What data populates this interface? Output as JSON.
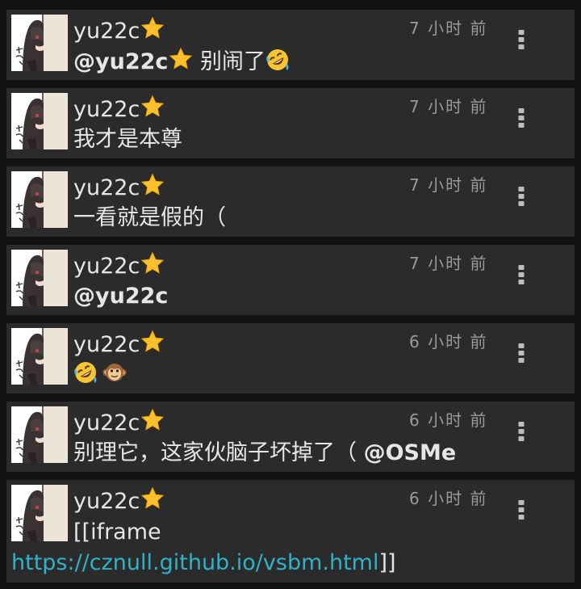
{
  "messages": [
    {
      "user": "yu22c",
      "time": "7 小时 前",
      "mention": "@yu22c",
      "text": " 别闹了",
      "emoji": "rofl"
    },
    {
      "user": "yu22c",
      "time": "7 小时 前",
      "text": "我才是本尊"
    },
    {
      "user": "yu22c",
      "time": "7 小时 前",
      "text": "一看就是假的（"
    },
    {
      "user": "yu22c",
      "time": "7 小时 前",
      "mention": "@yu22c"
    },
    {
      "user": "yu22c",
      "time": "6 小时 前",
      "emojis": [
        "rofl",
        "monkey-face"
      ]
    },
    {
      "user": "yu22c",
      "time": "6 小时 前",
      "text": "别理它，这家伙脑子坏掉了（ ",
      "mention": "@OSMe"
    },
    {
      "user": "yu22c",
      "time": "6 小时 前",
      "prefix": "[[iframe",
      "link": "https://cznull.github.io/vsbm.html",
      "suffix": "]]"
    }
  ],
  "icons": {
    "user_badge": "star-icon",
    "menu": "more-vertical-icon",
    "avatar": "anime-girl-avatar"
  },
  "colors": {
    "background": "#121212",
    "card": "#2b2b2b",
    "text": "#e6e6e6",
    "time": "#9a9a9a",
    "link": "#2fb3c9"
  }
}
